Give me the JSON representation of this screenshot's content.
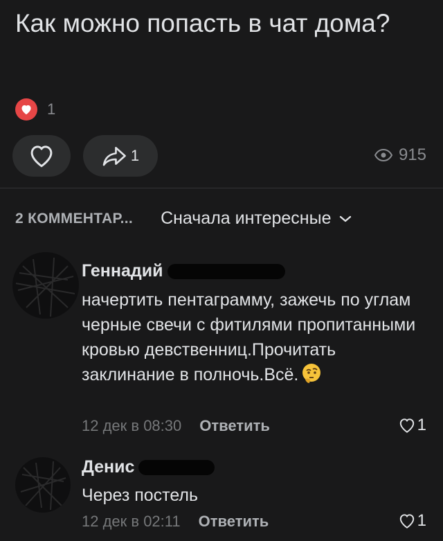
{
  "post": {
    "title": "Как можно попасть в чат дома?",
    "reaction_count": "1",
    "share_count": "1",
    "views": "915"
  },
  "comments_header": {
    "count_label": "2 КОММЕНТАР...",
    "sort_label": "Сначала интересные"
  },
  "comments": [
    {
      "author": "Геннадий",
      "text": "начертить пентаграмму, зажечь по углам черные свечи с фитилями пропитанными кровью девственниц.Прочитать заклинание в полночь.Всё.",
      "emoji": "thinking-face",
      "date": "12 дек в 08:30",
      "reply_label": "Ответить",
      "likes": "1"
    },
    {
      "author": "Денис",
      "text": "Через постель",
      "date": "12 дек в 02:11",
      "reply_label": "Ответить",
      "likes": "1"
    }
  ],
  "colors": {
    "background": "#19191a",
    "button": "#2c2d2e",
    "heart_badge": "#e64646",
    "text_primary": "#e1e3e6",
    "text_secondary": "#76787a"
  }
}
